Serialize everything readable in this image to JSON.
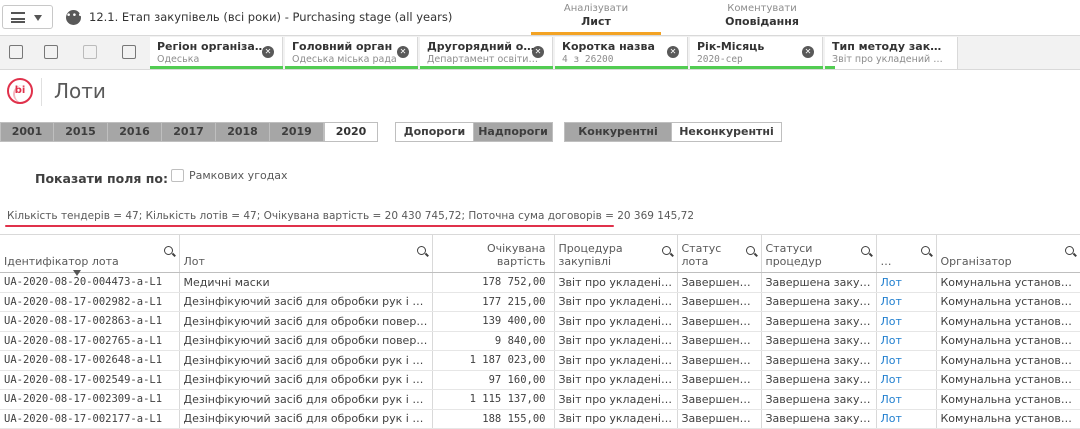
{
  "topbar": {
    "app_title": "12.1. Етап закупівель (всі роки) - Purchasing stage (all years)",
    "tabs": [
      {
        "sub": "Аналізувати",
        "main": "Лист"
      },
      {
        "sub": "Коментувати",
        "main": "Оповідання"
      }
    ]
  },
  "selections": [
    {
      "title": "Регіон організа…",
      "value": "Одеська"
    },
    {
      "title": "Головний орган",
      "value": "Одеська міська рада"
    },
    {
      "title": "Другорядний о…",
      "value": "Департамент освіти …"
    },
    {
      "title": "Коротка назва",
      "value": "4 з 26200"
    },
    {
      "title": "Рік-Місяць",
      "value": "2020-сер"
    },
    {
      "title": "Тип методу заку…",
      "value": "Звіт про укладений …"
    }
  ],
  "page_title": "Лоти",
  "logo_text": "bi",
  "years": [
    "2001",
    "2015",
    "2016",
    "2017",
    "2018",
    "2019",
    "2020"
  ],
  "selected_year": "2020",
  "threshold_buttons": [
    "Допороги",
    "Надпороги"
  ],
  "competition_buttons": [
    "Конкурентні",
    "Неконкурентні"
  ],
  "show_fields": {
    "label": "Показати поля по:",
    "checkbox_label": "Рамкових угодах"
  },
  "summary": "Кількість тендерів = 47; Кількість лотів = 47; Очікувана вартість = 20 430 745,72; Поточна сума договорів = 20 369 145,72",
  "table": {
    "headers": [
      "Ідентифікатор лота",
      "Лот",
      "Очікувана вартість",
      "Процедура закупівлі",
      "Статус лота",
      "Статуси процедур",
      "…",
      "Організатор"
    ],
    "rows": [
      [
        "UA-2020-08-20-004473-a-L1",
        "Медичні маски",
        "178 752,00",
        "Звіт про укладені…",
        "Завершено …",
        "Завершена закупі…",
        "Лот",
        "Комунальна установа \"…"
      ],
      [
        "UA-2020-08-17-002982-a-L1",
        "Дезінфікуючий засіб для обробки рук і шкі…",
        "177 215,00",
        "Звіт про укладені…",
        "Завершено …",
        "Завершена закупі…",
        "Лот",
        "Комунальна установа \"…"
      ],
      [
        "UA-2020-08-17-002863-a-L1",
        "Дезінфікуючий засіб для обробки поверхо…",
        "139 400,00",
        "Звіт про укладені…",
        "Завершено …",
        "Завершена закупі…",
        "Лот",
        "Комунальна установа \"…"
      ],
      [
        "UA-2020-08-17-002765-a-L1",
        "Дезінфікуючий засіб для обробки поверхо…",
        "9 840,00",
        "Звіт про укладені…",
        "Завершено …",
        "Завершена закупі…",
        "Лот",
        "Комунальна установа \"…"
      ],
      [
        "UA-2020-08-17-002648-a-L1",
        "Дезінфікуючий засіб для обробки рук і шкі…",
        "1 187 023,00",
        "Звіт про укладені…",
        "Завершено …",
        "Завершена закупі…",
        "Лот",
        "Комунальна установа \"…"
      ],
      [
        "UA-2020-08-17-002549-a-L1",
        "Дезінфікуючий засіб для обробки рук і шкі…",
        "97 160,00",
        "Звіт про укладені…",
        "Завершено …",
        "Завершена закупі…",
        "Лот",
        "Комунальна установа \"…"
      ],
      [
        "UA-2020-08-17-002309-a-L1",
        "Дезінфікуючий засіб для обробки рук і шкі…",
        "1 115 137,00",
        "Звіт про укладені…",
        "Завершено …",
        "Завершена закупі…",
        "Лот",
        "Комунальна установа \"…"
      ],
      [
        "UA-2020-08-17-002177-a-L1",
        "Дезінфікуючий засіб для обробки рук і шкі…",
        "188 155,00",
        "Звіт про укладені…",
        "Завершено …",
        "Завершена закупі…",
        "Лот",
        "Комунальна установа \"…"
      ]
    ]
  },
  "colors": {
    "accent": "#f3a324",
    "brand_red": "#e0314b",
    "selection_green": "#52cc52",
    "link": "#1f7ecf"
  }
}
